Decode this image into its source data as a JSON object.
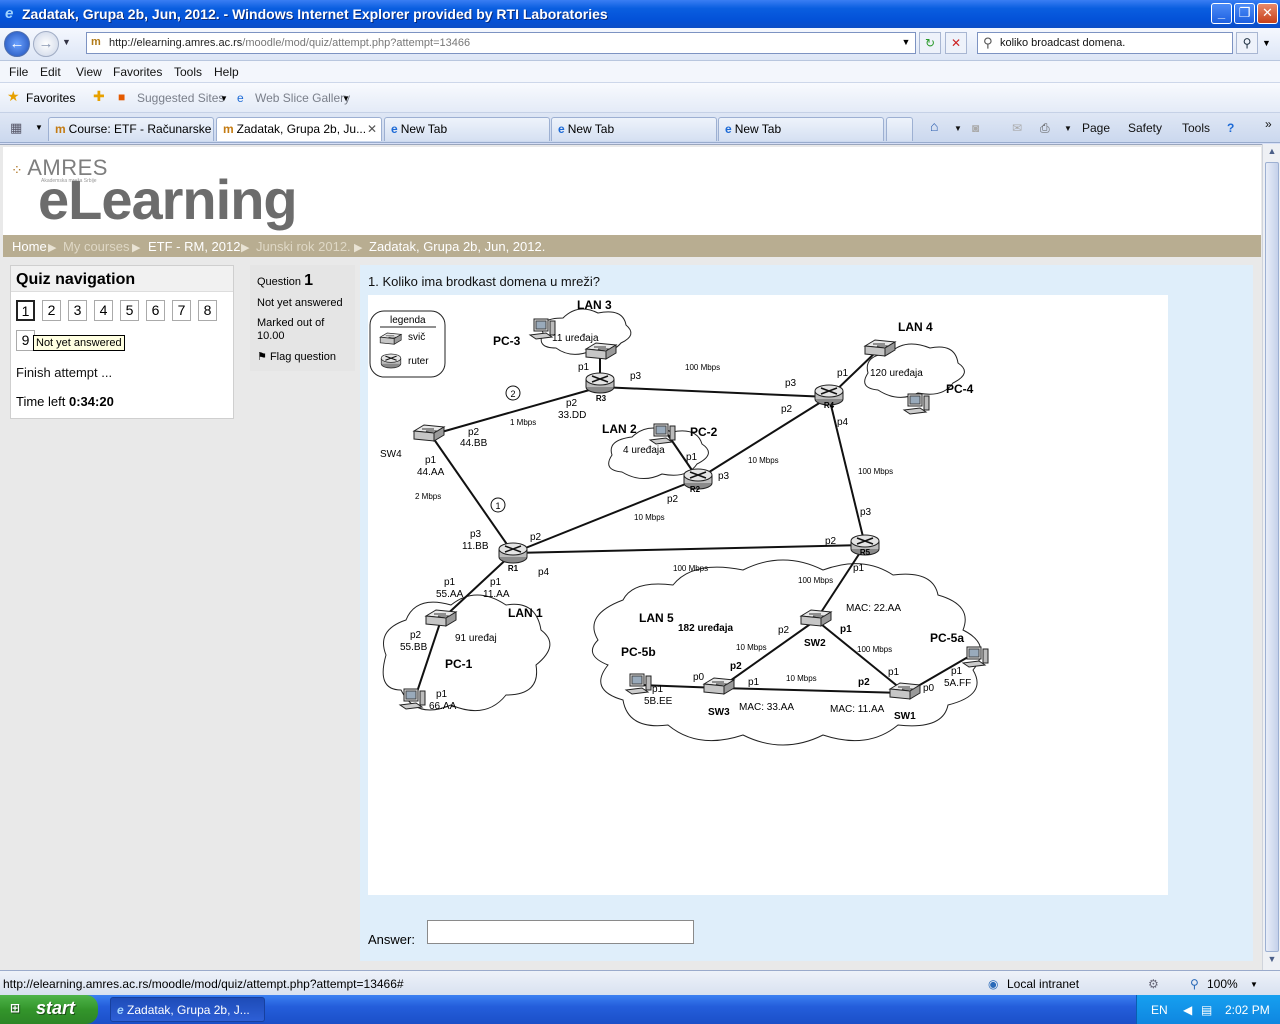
{
  "window": {
    "title": "Zadatak, Grupa 2b, Jun, 2012. - Windows Internet Explorer provided by RTI Laboratories"
  },
  "navbar": {
    "url_host": "http://elearning.amres.ac.rs",
    "url_path": "/moodle/mod/quiz/attempt.php?attempt=13466",
    "search_text": "koliko broadcast domena."
  },
  "menu": [
    "File",
    "Edit",
    "View",
    "Favorites",
    "Tools",
    "Help"
  ],
  "favbar": {
    "favorites": "Favorites",
    "suggested": "Suggested Sites",
    "webslice": "Web Slice Gallery"
  },
  "tabs": [
    {
      "label": "Course: ETF - Računarske ..."
    },
    {
      "label": "Zadatak, Grupa 2b, Ju..."
    },
    {
      "label": "New Tab"
    },
    {
      "label": "New Tab"
    },
    {
      "label": "New Tab"
    }
  ],
  "commandbar": {
    "page": "Page",
    "safety": "Safety",
    "tools": "Tools"
  },
  "site": {
    "logo_top": "AMRES",
    "logo_sub": "Akademska mreža Srbije",
    "logo_main": "eLearning"
  },
  "breadcrumb": [
    "Home",
    "My courses",
    "ETF - RM, 2012",
    "Junski rok 2012.",
    "Zadatak, Grupa 2b, Jun, 2012."
  ],
  "quiz_nav": {
    "title": "Quiz navigation",
    "questions": [
      "1",
      "2",
      "3",
      "4",
      "5",
      "6",
      "7",
      "8",
      "9"
    ],
    "tooltip": "Not yet answered",
    "finish": "Finish attempt ...",
    "time_label": "Time left",
    "time_value": "0:34:20"
  },
  "question": {
    "label": "Question",
    "number": "1",
    "state": "Not yet answered",
    "marks": "Marked out of 10.00",
    "flag": "Flag question",
    "text": "1. Koliko ima brodkast domena u mreži?",
    "answer_label": "Answer:",
    "answer_value": ""
  },
  "diagram": {
    "legend_title": "legenda",
    "legend_switch": "svič",
    "legend_router": "ruter",
    "routers": [
      "R1",
      "R2",
      "R3",
      "R4",
      "R5"
    ],
    "switches": [
      "SW1",
      "SW2",
      "SW3",
      "SW4"
    ],
    "lans": [
      {
        "name": "LAN 1",
        "devices": "91 uređaj"
      },
      {
        "name": "LAN 2",
        "devices": "4 uređaja"
      },
      {
        "name": "LAN 3",
        "devices": "11 uređaja"
      },
      {
        "name": "LAN 4",
        "devices": "120 uređaja"
      },
      {
        "name": "LAN 5",
        "devices": "182 uređaja"
      }
    ],
    "pcs": [
      "PC-1",
      "PC-2",
      "PC-3",
      "PC-4",
      "PC-5a",
      "PC-5b"
    ],
    "speeds": [
      "100 Mbps",
      "1 Mbps",
      "2 Mbps",
      "10 Mbps"
    ],
    "macs": [
      "MAC: 22.AA",
      "MAC: 33.AA",
      "MAC: 11.AA"
    ],
    "markers": [
      "1",
      "2"
    ]
  },
  "statusbar": {
    "url": "http://elearning.amres.ac.rs/moodle/mod/quiz/attempt.php?attempt=13466#",
    "zone": "Local intranet",
    "zoom": "100%"
  },
  "taskbar": {
    "start": "start",
    "item": "Zadatak, Grupa 2b, J...",
    "lang": "EN",
    "clock": "2:02 PM"
  }
}
